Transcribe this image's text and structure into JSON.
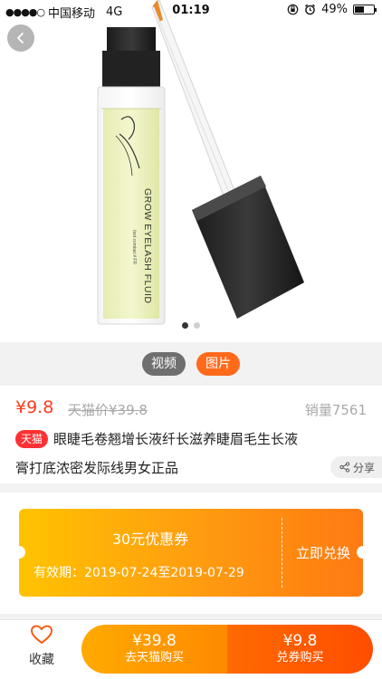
{
  "status_bar": {
    "carrier": "中国移动",
    "network": "4G",
    "time": "01:19",
    "battery": "49%"
  },
  "product_image": {
    "bottle_text_main": "GROW EYELASH FLUID",
    "bottle_text_sub": "fast combat # FR",
    "carousel_total": 2,
    "carousel_active": 1
  },
  "media_tabs": {
    "video_label": "视频",
    "photo_label": "图片"
  },
  "product": {
    "price": "¥9.8",
    "original_price": "天猫价¥39.8",
    "sales": "销量7561",
    "platform_badge": "天猫",
    "title_line1": "眼睫毛卷翘增长液纤长滋养睫眉毛生长液",
    "title_line2": "膏打底浓密发际线男女正品",
    "share_label": "分享"
  },
  "coupon": {
    "amount_text": "30元优惠券",
    "validity_text": "有效期：2019-07-24至2019-07-29",
    "redeem_label": "立即兑换"
  },
  "bottom_bar": {
    "favorite_label": "收藏",
    "tmall_buy_price": "¥39.8",
    "tmall_buy_label": "去天猫购买",
    "coupon_buy_price": "¥9.8",
    "coupon_buy_label": "兑券购买"
  },
  "colors": {
    "accent": "#ff6a1a",
    "price_red": "#ff3c1f",
    "tmall_red": "#ff3033"
  }
}
